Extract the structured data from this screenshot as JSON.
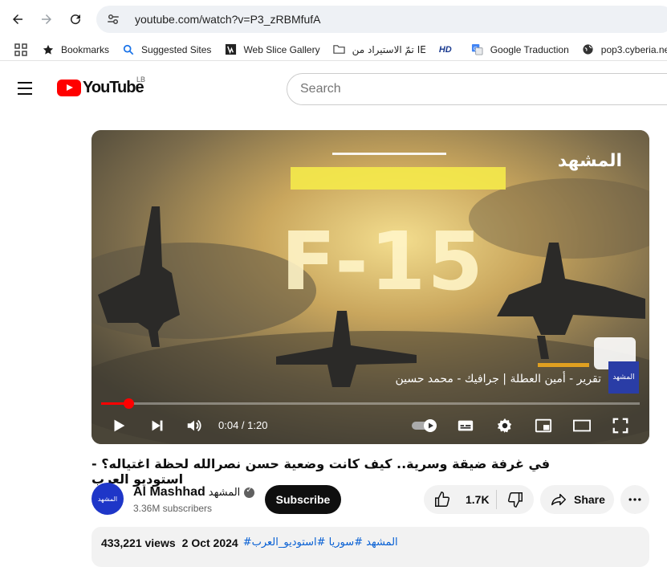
{
  "browser": {
    "url": "youtube.com/watch?v=P3_zRBMfufA",
    "bookmarks": [
      {
        "label": "Bookmarks",
        "icon": "star-icon"
      },
      {
        "label": "Suggested Sites",
        "icon": "search-icon"
      },
      {
        "label": "Web Slice Gallery",
        "icon": "web-slice-icon"
      },
      {
        "label": "تمّ الاستيراد من IE",
        "icon": "folder-icon"
      },
      {
        "label": "",
        "icon": "hd-icon"
      },
      {
        "label": "Google Traduction",
        "icon": "translate-icon"
      },
      {
        "label": "pop3.cyberia.net.lb",
        "icon": "globe-icon"
      }
    ]
  },
  "header": {
    "logo_text": "YouTube",
    "country": "LB",
    "search_placeholder": "Search"
  },
  "video": {
    "brand_overlay": "المشهد",
    "big_text": "F-15",
    "credit_text": "تقرير - أمين العطلة | جرافيك - محمد حسين",
    "corner_logo": "المشهد",
    "progress": 0.05,
    "time": "0:04 / 1:20"
  },
  "info": {
    "title": "في غرفة ضيقة وسرية.. كيف كانت وضعية حسن نصرالله لحظة اغتياله؟ - استوديو العرب",
    "channel_avatar_text": "المشهد",
    "channel_name": "Al Mashhad",
    "channel_name_ar": "المشهد",
    "subscribers": "3.36M subscribers",
    "subscribe_label": "Subscribe",
    "likes": "1.7K",
    "share_label": "Share",
    "views": "433,221 views",
    "date": "2 Oct 2024",
    "tags": "#المشهد #سوريا #استوديو_العرب"
  }
}
